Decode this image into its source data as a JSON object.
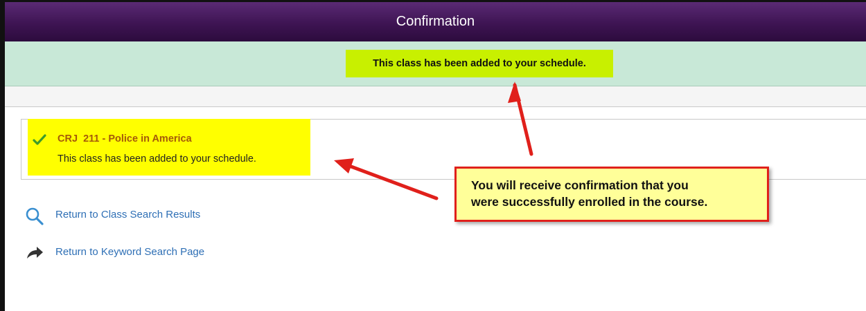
{
  "header": {
    "title": "Confirmation"
  },
  "banner": {
    "message": "This class has been added to your schedule."
  },
  "result": {
    "course_title": "CRJ  211 - Police in America",
    "message": "This class has been added to your schedule.",
    "status_icon": "checkmark-icon"
  },
  "links": [
    {
      "label": "Return to Class Search Results",
      "icon": "search-icon"
    },
    {
      "label": "Return to Keyword Search Page",
      "icon": "return-arrow-icon"
    }
  ],
  "annotation": {
    "line1": "You will receive confirmation that you",
    "line2": "were successfully enrolled in the course."
  },
  "colors": {
    "header": "#3e1453",
    "banner": "#c8e8d7",
    "highlight": "#ffff00",
    "link": "#2e6fb5",
    "course_title": "#a4590a",
    "callout_border": "#e0201b",
    "callout_fill": "#ffff99"
  }
}
